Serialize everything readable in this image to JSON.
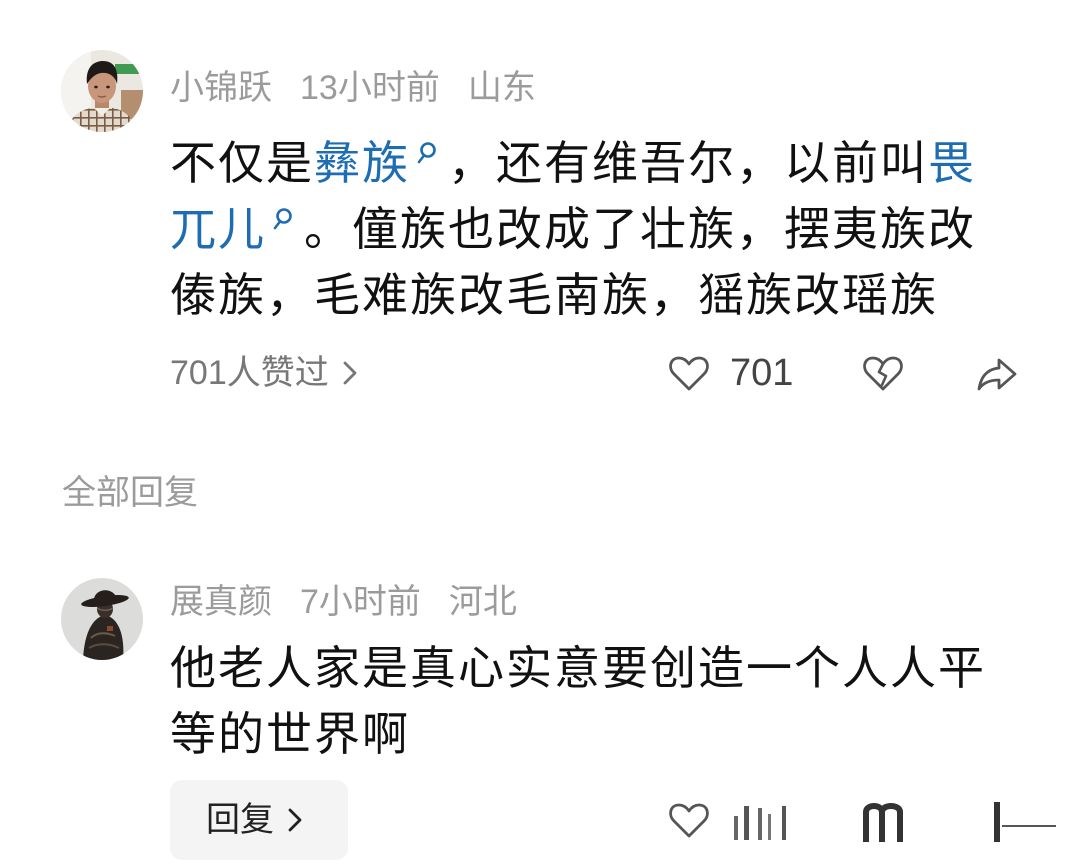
{
  "comment": {
    "author": {
      "name": "小锦跃",
      "time": "13小时前",
      "location": "山东",
      "avatar": "man-photo-avatar"
    },
    "segments": [
      {
        "text": "不仅是",
        "link": false
      },
      {
        "text": "彝族",
        "link": true
      },
      {
        "text": "，还有维吾尔，以前叫",
        "link": false
      },
      {
        "text": "畏兀儿",
        "link": true
      },
      {
        "text": "。僮族也改成了壮族，摆夷族改傣族，毛难族改毛南族，猺族改瑶族",
        "link": false
      }
    ],
    "likes_summary": "701人赞过",
    "like_count": "701",
    "icons": {
      "topic_search": "search-icon",
      "like": "heart-icon",
      "dislike": "broken-heart-icon",
      "share": "share-icon",
      "more": "chevron-right-icon"
    }
  },
  "replies_section": {
    "title": "全部回复"
  },
  "reply": {
    "author": {
      "name": "展真颜",
      "time": "7小时前",
      "location": "河北",
      "avatar": "cowboy-figure-avatar"
    },
    "text": "他老人家是真心实意要创造一个人人平等的世界啊",
    "reply_button_label": "回复",
    "icons": {
      "like": "heart-icon",
      "reply_more": "chevron-right-icon"
    }
  },
  "colors": {
    "background": "#ffffff",
    "text": "#111111",
    "meta": "#9b9b9b",
    "secondary": "#777777",
    "link": "#1e6db3",
    "button_bg": "#f4f4f4",
    "icon": "#555555"
  }
}
